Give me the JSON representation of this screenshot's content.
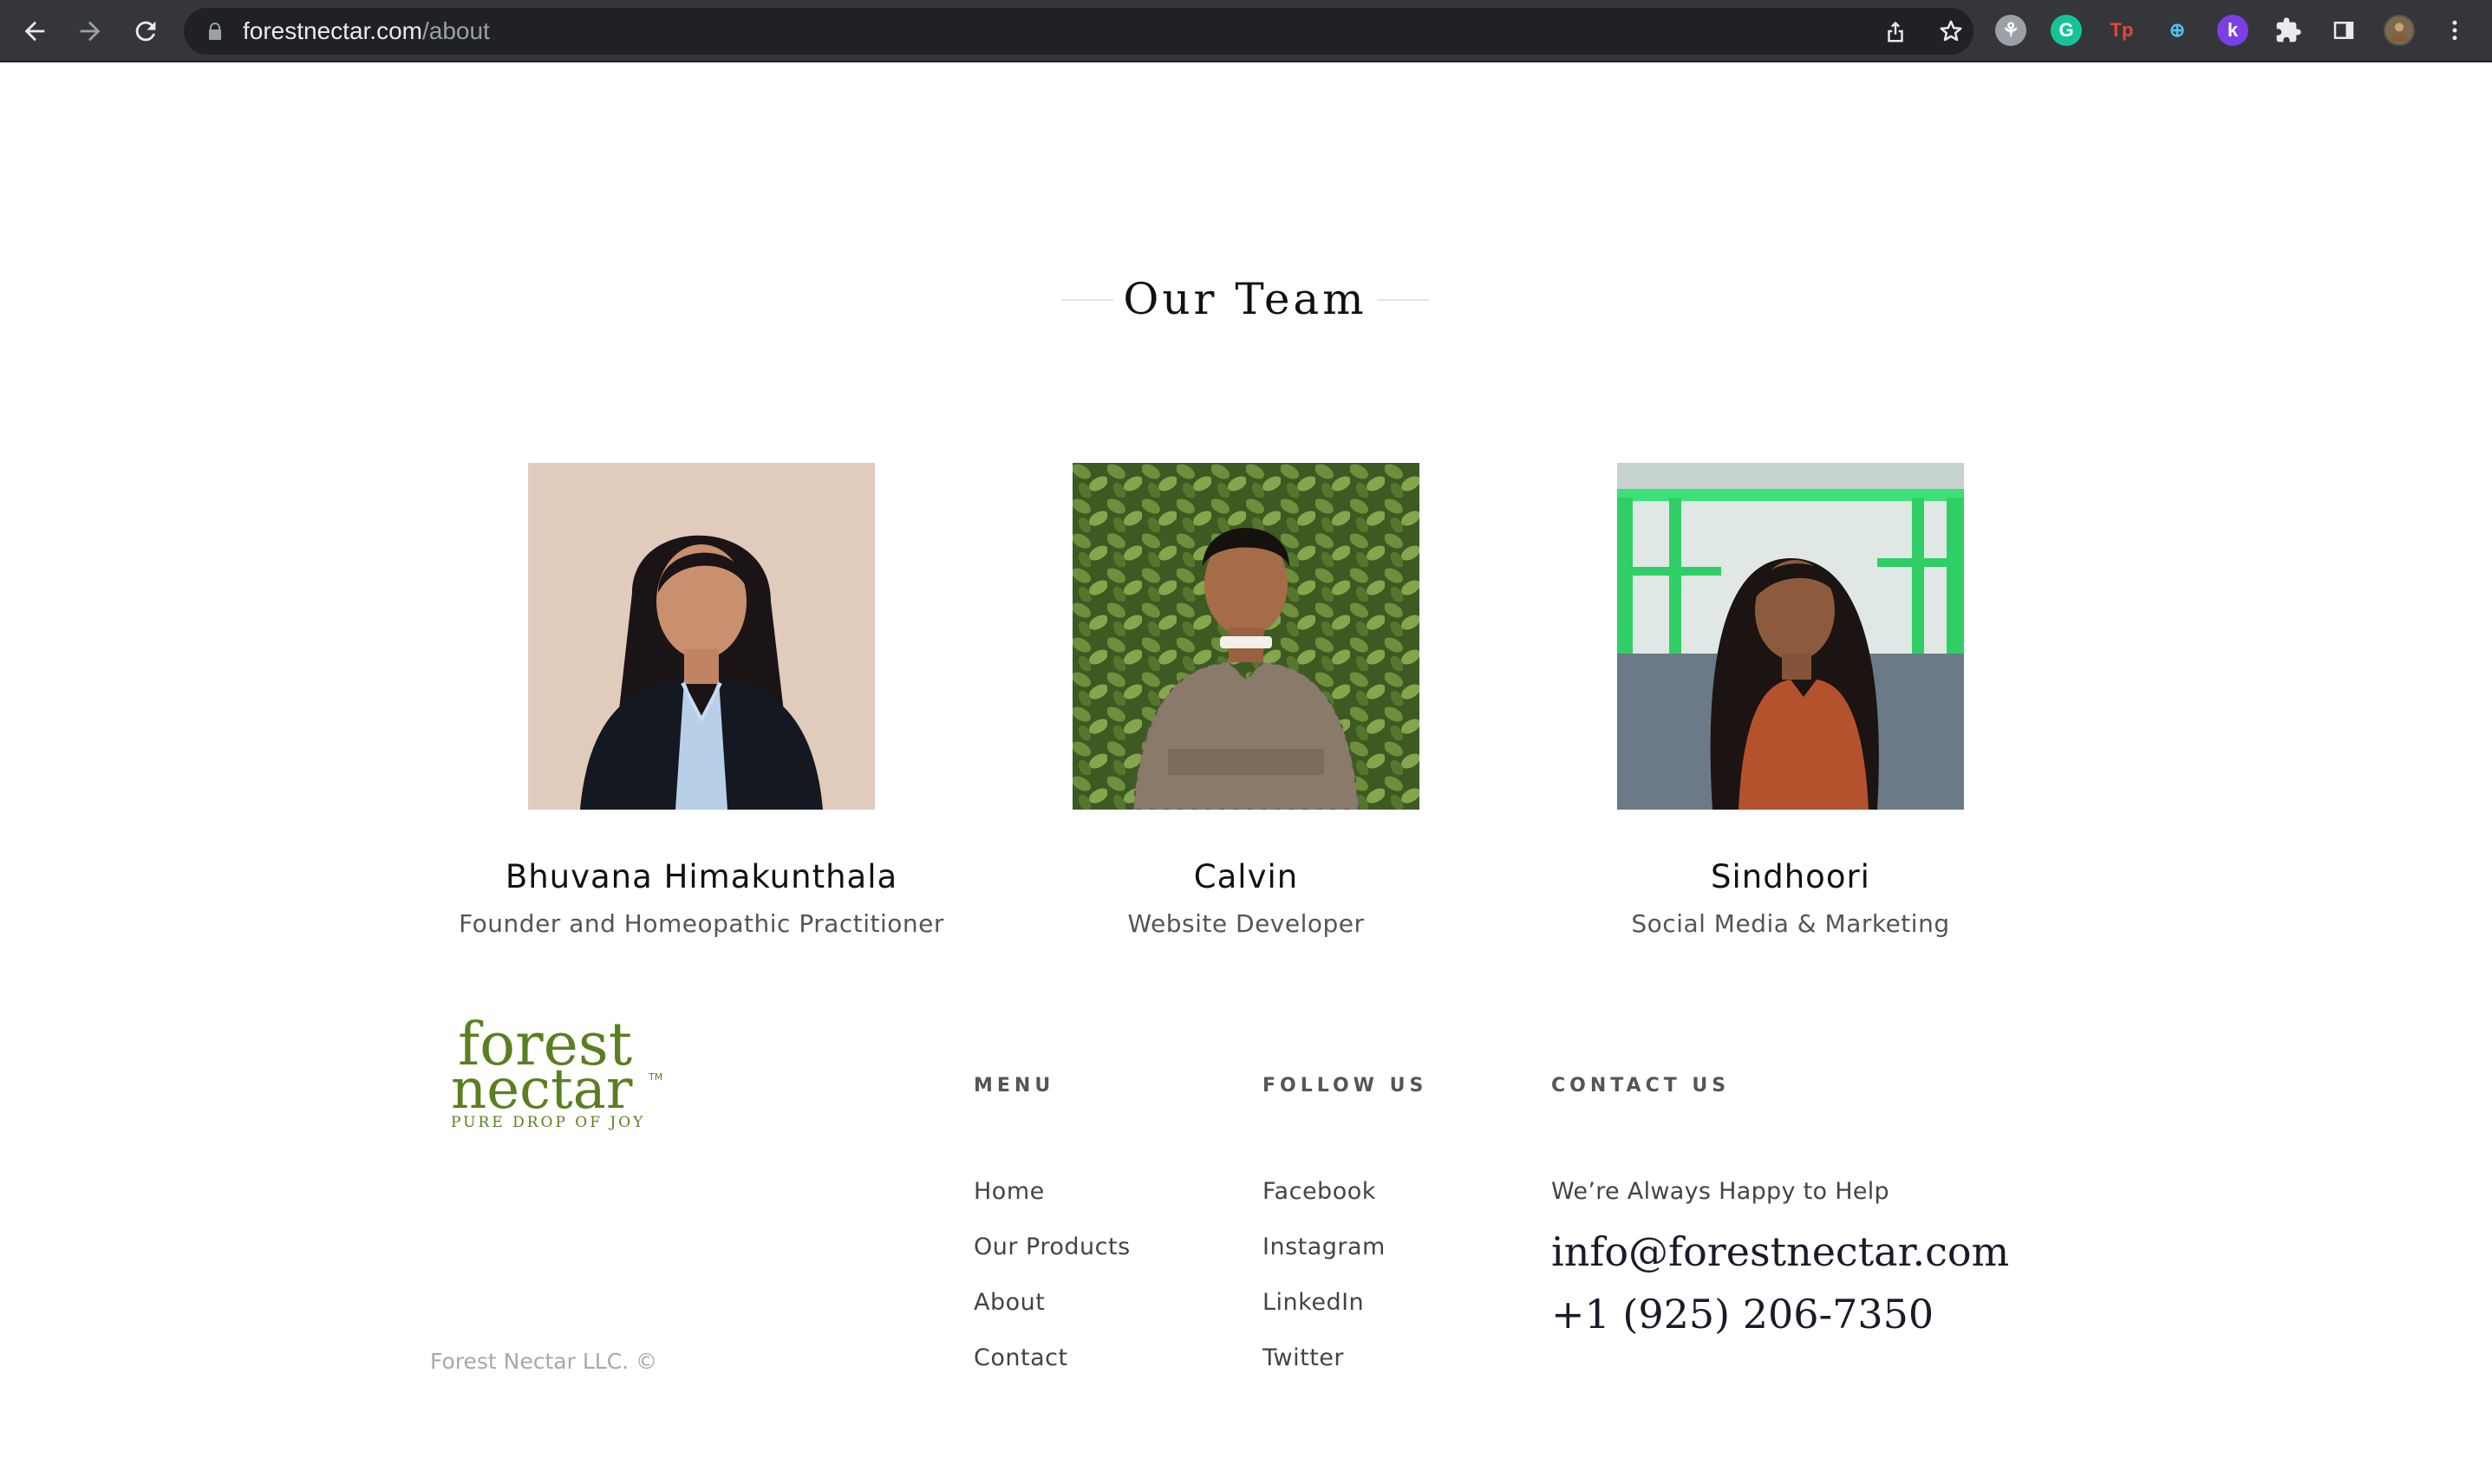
{
  "browser": {
    "url_domain": "forestnectar.com",
    "url_path": "/about",
    "extensions": [
      {
        "name": "ext-grey-icon",
        "glyph": "⚘",
        "bg": "#9aa0a6",
        "fg": "#ffffff"
      },
      {
        "name": "grammarly-icon",
        "glyph": "G",
        "bg": "#15c39a",
        "fg": "#ffffff"
      },
      {
        "name": "tp-extension-icon",
        "glyph": "Tp",
        "bg": "transparent",
        "fg": "#e8453c"
      },
      {
        "name": "plus-circle-extension-icon",
        "glyph": "⊕",
        "bg": "transparent",
        "fg": "#4fc3f7"
      },
      {
        "name": "k-extension-icon",
        "glyph": "k",
        "bg": "#7b3fe4",
        "fg": "#ffffff"
      }
    ]
  },
  "team": {
    "heading": "Our Team",
    "members": [
      {
        "name": "Bhuvana Himakunthala",
        "role": "Founder and Homeopathic Practitioner"
      },
      {
        "name": "Calvin",
        "role": "Website Developer"
      },
      {
        "name": "Sindhoori",
        "role": "Social Media & Marketing"
      }
    ]
  },
  "footer": {
    "logo": {
      "line1": "forest",
      "line2": "nectar",
      "tm": "TM",
      "tagline": "PURE DROP OF JOY",
      "color": "#5b7f1f"
    },
    "copyright": "Forest Nectar LLC. ©",
    "menu": {
      "title": "MENU",
      "links": [
        "Home",
        "Our Products",
        "About",
        "Contact"
      ]
    },
    "follow": {
      "title": "FOLLOW US",
      "links": [
        "Facebook",
        "Instagram",
        "LinkedIn",
        "Twitter"
      ]
    },
    "contact": {
      "title": "CONTACT US",
      "tagline": "We’re Always Happy to Help",
      "email": "info@forestnectar.com",
      "phone": "+1 (925) 206-7350"
    }
  }
}
